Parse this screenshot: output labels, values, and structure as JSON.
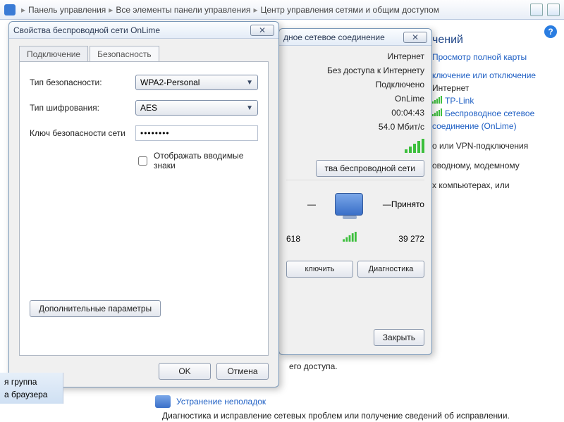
{
  "breadcrumb": {
    "items": [
      "Панель управления",
      "Все элементы панели управления",
      "Центр управления сетями и общим доступом"
    ]
  },
  "props_dialog": {
    "title": "Свойства беспроводной сети OnLime",
    "tabs": {
      "connection": "Подключение",
      "security": "Безопасность"
    },
    "labels": {
      "sec_type": "Тип безопасности:",
      "encryption": "Тип шифрования:",
      "key": "Ключ безопасности сети"
    },
    "values": {
      "sec_type": "WPA2-Personal",
      "encryption": "AES",
      "key": "••••••••"
    },
    "show_chars": "Отображать вводимые знаки",
    "advanced": "Дополнительные параметры",
    "ok": "OK",
    "cancel": "Отмена"
  },
  "status_dialog": {
    "title": "дное сетевое соединение",
    "kv": {
      "internet": "Интернет",
      "noaccess": "Без доступа к Интернету",
      "connected": "Подключено",
      "ssid": "OnLime",
      "duration": "00:04:43",
      "speed": "54.0 Мбит/с"
    },
    "props_btn": "тва беспроводной сети",
    "received_label": "Принято",
    "sent_bytes": "618",
    "recv_bytes": "39 272",
    "disconnect": "ключить",
    "diagnose": "Диагностика",
    "close": "Закрыть"
  },
  "right": {
    "heading": "чений",
    "full_map": "Просмотр полной карты",
    "conn_disc": "ключение или отключение",
    "internet": "Интернет",
    "tplink": "TP-Link",
    "wlan": "Беспроводное сетевое соединение (OnLime)",
    "vpn": "о или VPN-подключения",
    "modem": "оводному, модемному",
    "computers": "х компьютерах, или"
  },
  "bottom": {
    "access": "его доступа.",
    "sidebar1": "я группа",
    "sidebar2": "а браузера",
    "troubleshoot": "Устранение неполадок",
    "diag": "Диагностика и исправление сетевых проблем или получение сведений об исправлении."
  }
}
